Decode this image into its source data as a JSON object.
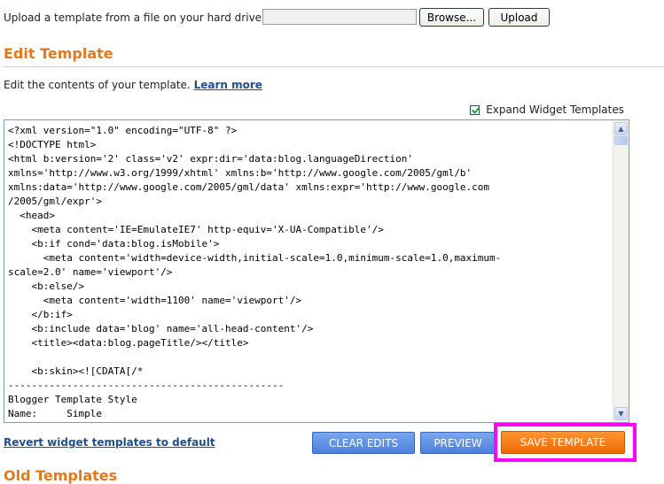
{
  "upload": {
    "label": "Upload a template from a file on your hard drive:",
    "browse_label": "Browse...",
    "upload_label": "Upload"
  },
  "edit": {
    "title": "Edit Template",
    "description": "Edit the contents of your template.",
    "learn_more": "Learn more",
    "expand_label": "Expand Widget Templates",
    "expand_checked": true
  },
  "editor": {
    "code": "<?xml version=\"1.0\" encoding=\"UTF-8\" ?>\n<!DOCTYPE html>\n<html b:version='2' class='v2' expr:dir='data:blog.languageDirection'\nxmlns='http://www.w3.org/1999/xhtml' xmlns:b='http://www.google.com/2005/gml/b'\nxmlns:data='http://www.google.com/2005/gml/data' xmlns:expr='http://www.google.com\n/2005/gml/expr'>\n  <head>\n    <meta content='IE=EmulateIE7' http-equiv='X-UA-Compatible'/>\n    <b:if cond='data:blog.isMobile'>\n      <meta content='width=device-width,initial-scale=1.0,minimum-scale=1.0,maximum-\nscale=2.0' name='viewport'/>\n    <b:else/>\n      <meta content='width=1100' name='viewport'/>\n    </b:if>\n    <b:include data='blog' name='all-head-content'/>\n    <title><data:blog.pageTitle/></title>\n\n    <b:skin><![CDATA[/*\n-----------------------------------------------\nBlogger Template Style\nName:     Simple"
  },
  "actions": {
    "revert_label": "Revert widget templates to default",
    "clear_label": "CLEAR EDITS",
    "preview_label": "PREVIEW",
    "save_label": "SAVE TEMPLATE"
  },
  "old": {
    "title": "Old Templates"
  },
  "colors": {
    "heading_orange": "#e0791e",
    "link_blue": "#1f4f8f",
    "button_blue": "#4d7fdc",
    "save_orange": "#f06a00",
    "highlight_magenta": "#ff00ff"
  }
}
